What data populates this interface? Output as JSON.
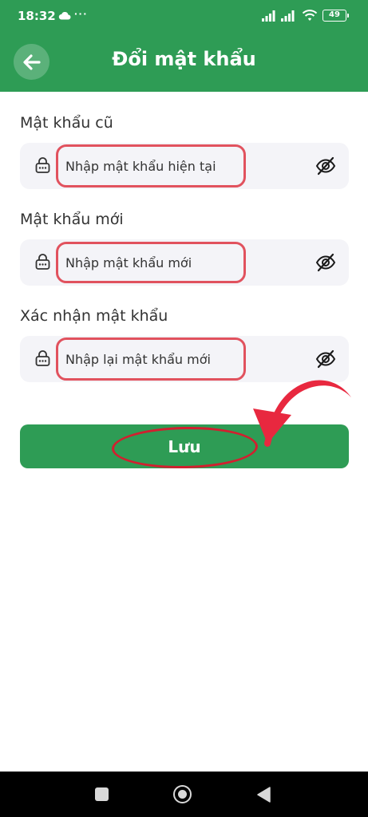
{
  "status_bar": {
    "time": "18:32",
    "dots": "···",
    "battery": "49"
  },
  "header": {
    "title": "Đổi mật khẩu",
    "back_icon": "arrow-left-icon"
  },
  "form": {
    "old_password": {
      "label": "Mật khẩu cũ",
      "placeholder": "Nhập mật khẩu hiện tại"
    },
    "new_password": {
      "label": "Mật khẩu mới",
      "placeholder": "Nhập mật khẩu mới"
    },
    "confirm_password": {
      "label": "Xác nhận mật khẩu",
      "placeholder": "Nhập lại mật khẩu mới"
    }
  },
  "save_label": "Lưu",
  "colors": {
    "brand_green": "#2e9c55",
    "field_bg": "#f4f4f8",
    "annotation_red": "#e1525e",
    "arrow_red": "#e8283f"
  }
}
